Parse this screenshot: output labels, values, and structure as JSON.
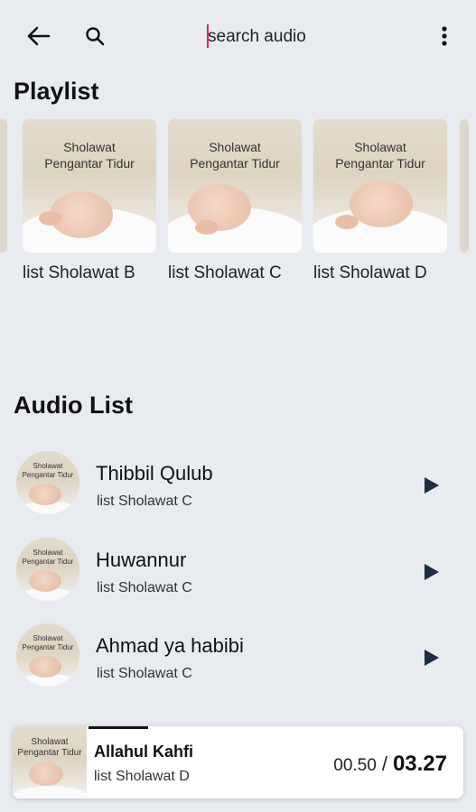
{
  "search": {
    "placeholder": "search audio"
  },
  "icons": {
    "back": "arrow-left-icon",
    "search": "search-icon",
    "more": "more-vertical-icon",
    "play": "play-icon"
  },
  "colors": {
    "background": "#e8ebf0",
    "caret": "#e0245e",
    "play": "#1f2d44"
  },
  "sections": {
    "playlist": "Playlist",
    "audio": "Audio List"
  },
  "cover_text": {
    "line1": "Sholawat",
    "line2": "Pengantar Tidur"
  },
  "playlists": [
    {
      "label": "list Sholawat B"
    },
    {
      "label": "list Sholawat C"
    },
    {
      "label": "list Sholawat D"
    }
  ],
  "audio_list": [
    {
      "title": "Thibbil Qulub",
      "playlist": "list Sholawat C"
    },
    {
      "title": "Huwannur",
      "playlist": "list Sholawat C"
    },
    {
      "title": "Ahmad ya habibi",
      "playlist": "list Sholawat C"
    }
  ],
  "player": {
    "title": "Allahul Kahfi",
    "playlist": "list Sholawat D",
    "current_time": "00.50",
    "separator": "/",
    "total_time": "03.27",
    "progress": 0.25
  }
}
